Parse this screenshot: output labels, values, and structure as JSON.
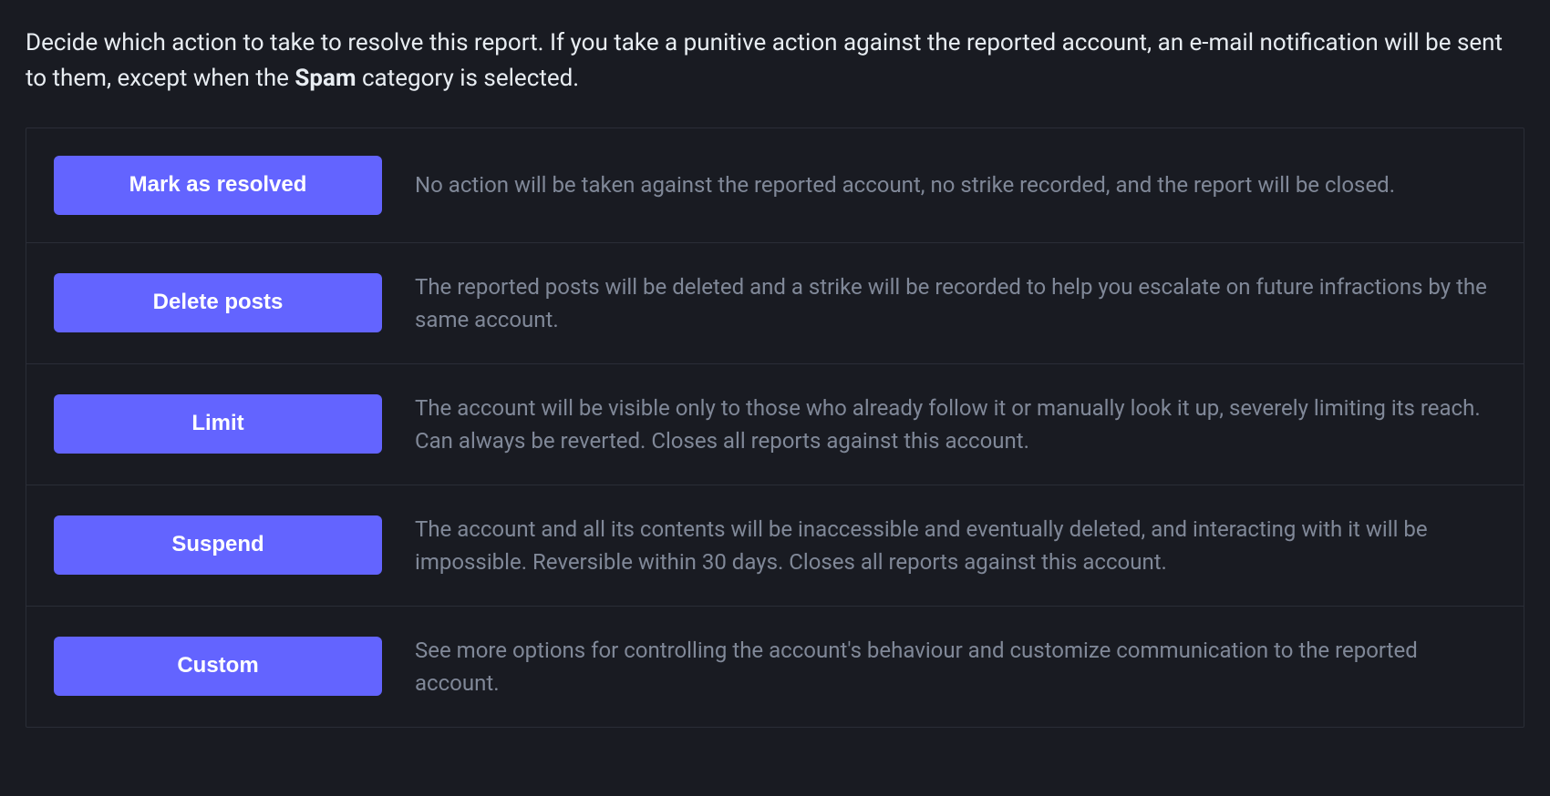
{
  "intro": {
    "prefix": "Decide which action to take to resolve this report. If you take a punitive action against the reported account, an e-mail notification will be sent to them, except when the ",
    "bold": "Spam",
    "suffix": " category is selected."
  },
  "actions": [
    {
      "key": "resolve",
      "label": "Mark as resolved",
      "description": "No action will be taken against the reported account, no strike recorded, and the report will be closed."
    },
    {
      "key": "delete-posts",
      "label": "Delete posts",
      "description": "The reported posts will be deleted and a strike will be recorded to help you escalate on future infractions by the same account."
    },
    {
      "key": "limit",
      "label": "Limit",
      "description": "The account will be visible only to those who already follow it or manually look it up, severely limiting its reach. Can always be reverted. Closes all reports against this account."
    },
    {
      "key": "suspend",
      "label": "Suspend",
      "description": "The account and all its contents will be inaccessible and eventually deleted, and interacting with it will be impossible. Reversible within 30 days. Closes all reports against this account."
    },
    {
      "key": "custom",
      "label": "Custom",
      "description": "See more options for controlling the account's behaviour and customize communication to the reported account."
    }
  ]
}
